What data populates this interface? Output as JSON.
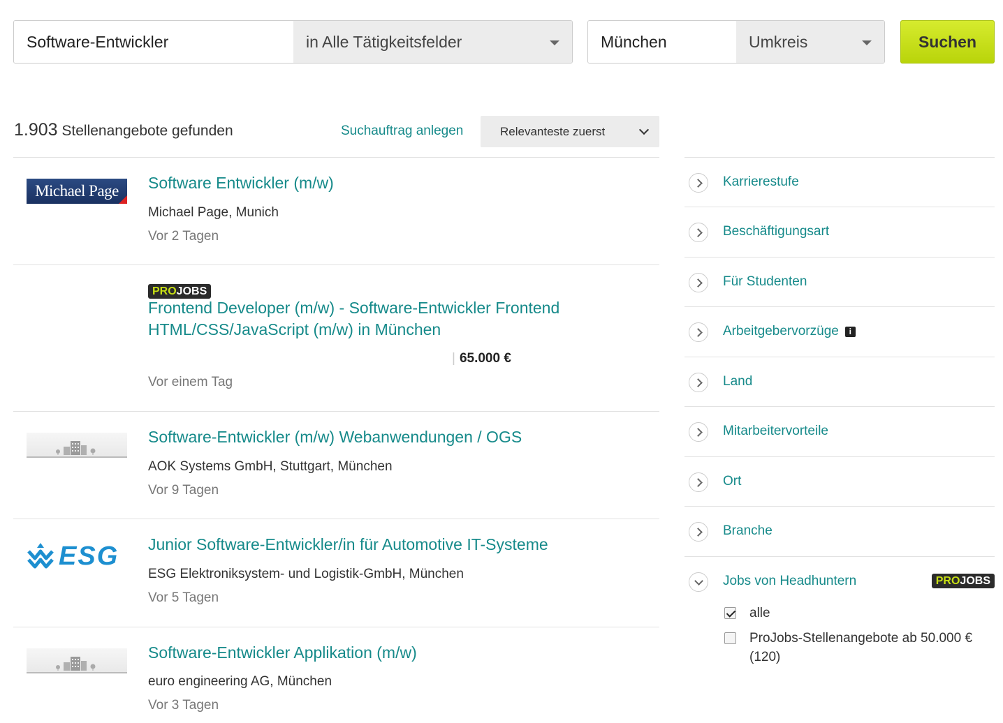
{
  "search": {
    "keyword": "Software-Entwickler",
    "category": "in Alle Tätigkeitsfelder",
    "location": "München",
    "radius": "Umkreis",
    "button": "Suchen"
  },
  "results": {
    "count": "1.903",
    "count_label": "Stellenangebote gefunden",
    "save_search": "Suchauftrag anlegen",
    "sort": "Relevanteste zuerst"
  },
  "projobs": {
    "pro": "PRO",
    "jobs": "JOBS"
  },
  "jobs": [
    {
      "title": "Software Entwickler (m/w)",
      "company": "Michael Page, Munich",
      "date": "Vor 2 Tagen",
      "logo": "Michael Page"
    },
    {
      "title_line1": "Frontend Developer (m/w) - Software-Entwickler Frontend",
      "title_line2": "HTML/CSS/JavaScript (m/w) in München",
      "salary": "65.000 €",
      "date": "Vor einem Tag"
    },
    {
      "title": "Software-Entwickler (m/w) Webanwendungen / OGS",
      "company": "AOK Systems GmbH, Stuttgart, München",
      "date": "Vor 9 Tagen"
    },
    {
      "title": "Junior Software-Entwickler/in für Automotive IT-Systeme",
      "company": "ESG Elektroniksystem- und Logistik-GmbH, München",
      "date": "Vor 5 Tagen",
      "logo": "ESG"
    },
    {
      "title": "Software-Entwickler Applikation (m/w)",
      "company": "euro engineering AG, München",
      "date": "Vor 3 Tagen"
    }
  ],
  "filters": [
    "Karrierestufe",
    "Beschäftigungsart",
    "Für Studenten",
    "Arbeitgebervorzüge",
    "Land",
    "Mitarbeitervorteile",
    "Ort",
    "Branche",
    "Jobs von Headhuntern"
  ],
  "headhunter_options": {
    "all": "alle",
    "projobs_line1": "ProJobs-Stellenangebote ab 50.000 €",
    "projobs_line2": "(120)"
  },
  "colors": {
    "accent": "#168a8a",
    "button": "#c7df14"
  }
}
